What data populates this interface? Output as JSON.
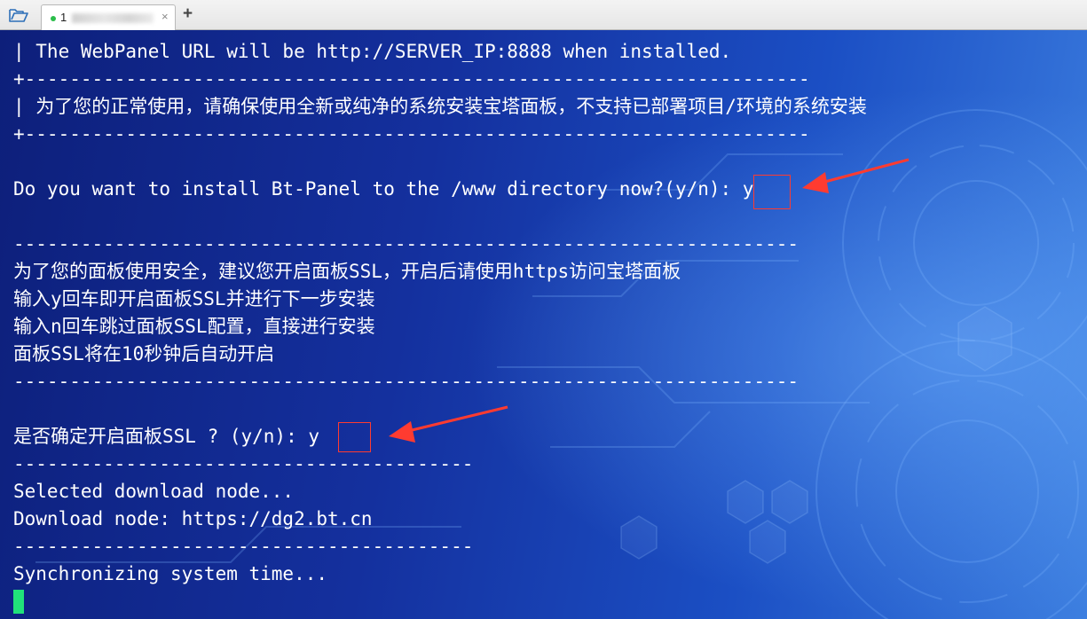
{
  "tabs": [
    {
      "label": "1",
      "status": "connected",
      "status_color": "#2bbd4a"
    }
  ],
  "icons": {
    "folder": "folder-open-icon",
    "close": "close-icon",
    "new_tab": "plus-icon"
  },
  "tab_close_glyph": "×",
  "new_tab_glyph": "+",
  "terminal": {
    "lines": [
      "| The WebPanel URL will be http://SERVER_IP:8888 when installed.",
      "+----------------------------------------------------------------------",
      "| 为了您的正常使用，请确保使用全新或纯净的系统安装宝塔面板，不支持已部署项目/环境的系统安装",
      "+----------------------------------------------------------------------",
      "",
      "Do you want to install Bt-Panel to the /www directory now?(y/n): y",
      "",
      "----------------------------------------------------------------------",
      "为了您的面板使用安全，建议您开启面板SSL，开启后请使用https访问宝塔面板",
      "输入y回车即开启面板SSL并进行下一步安装",
      "输入n回车跳过面板SSL配置，直接进行安装",
      "面板SSL将在10秒钟后自动开启",
      "----------------------------------------------------------------------",
      "",
      "是否确定开启面板SSL ? (y/n): y",
      "-----------------------------------------",
      "Selected download node...",
      "Download node: https://dg2.bt.cn",
      "-----------------------------------------",
      "Synchronizing system time..."
    ],
    "cursor_color": "#21e27a",
    "annotation_color": "#ff3b30"
  }
}
